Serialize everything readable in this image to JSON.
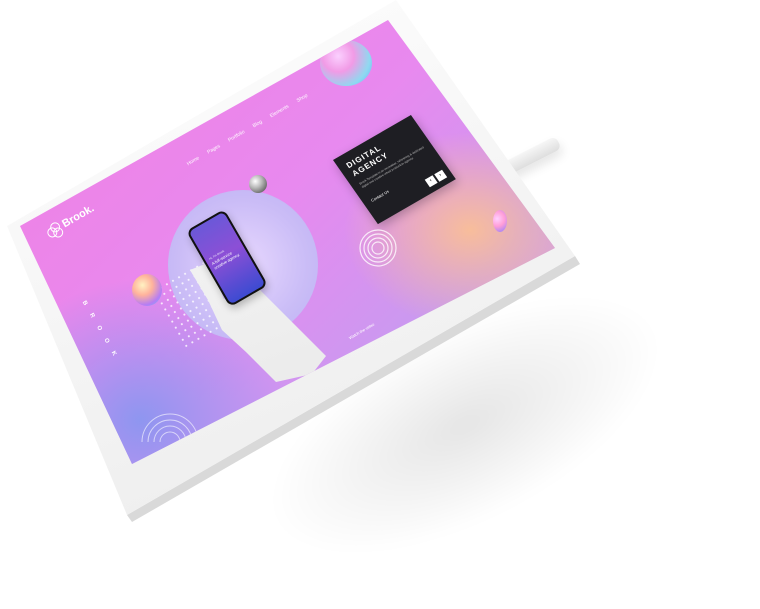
{
  "site": {
    "logo_text": "Brook.",
    "nav_items": [
      "Home",
      "Pages",
      "Portfolio",
      "Blog",
      "Elements",
      "Shop"
    ],
    "side_brand": "BROOK"
  },
  "hero_card": {
    "title": "DIGITAL\nAGENCY",
    "description": "Brook Template is an innovative, refreshing & dedicated digital and creative visual production agency.",
    "cta_label": "Contact Us",
    "prev_label": "‹",
    "next_label": "›"
  },
  "phone_screen": {
    "headline": "A full-service creative agency.",
    "brand": "Hi, I'm Brook"
  },
  "scroll_label": "Watch the video",
  "colors": {
    "gradient_pink": "#f27fe0",
    "gradient_violet": "#8a96f0",
    "gradient_orange": "#f4b58a",
    "card_bg": "#1e1e23"
  }
}
